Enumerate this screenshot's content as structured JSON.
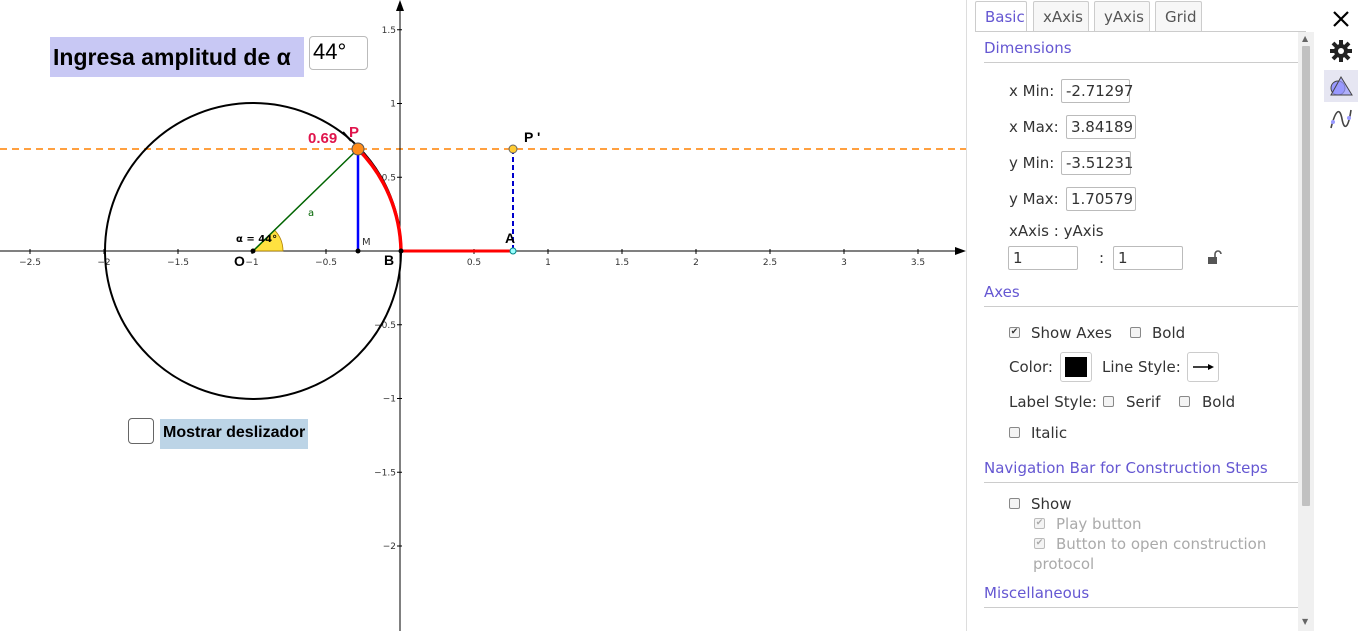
{
  "input": {
    "label": "Ingresa amplitud de α",
    "value": "44°"
  },
  "checkbox": {
    "label": "Mostrar deslizador"
  },
  "graph": {
    "x_ticks": [
      "−2.5",
      "−2",
      "−1.5",
      "−1",
      "−0.5",
      "0.5",
      "1",
      "1.5",
      "2",
      "2.5",
      "3",
      "3.5"
    ],
    "y_ticks": [
      "1.5",
      "1",
      "0.5",
      "−0.5",
      "−1",
      "−1.5",
      "−2"
    ],
    "value_label": "0.69",
    "point_labels": {
      "P": "P",
      "P_prime": "P '",
      "O": "O",
      "B": "B",
      "A": "A",
      "M": "M",
      "segment_a": "a"
    },
    "angle_label": "α = 44°",
    "colors": {
      "circle": "#000000",
      "arc": "#ff0000",
      "radius": "#006400",
      "vertical": "#0000ff",
      "dashed": "#ff8000",
      "point": "#ff9900",
      "angle_fill": "#ffd700"
    }
  },
  "panel": {
    "tabs": [
      "Basic",
      "xAxis",
      "yAxis",
      "Grid"
    ],
    "active_tab": "Basic",
    "dimensions_title": "Dimensions",
    "x_min_label": "x Min:",
    "x_min_value": "-2.71297",
    "x_max_label": "x Max:",
    "x_max_value": "3.84189",
    "y_min_label": "y Min:",
    "y_min_value": "-3.51231",
    "y_max_label": "y Max:",
    "y_max_value": "1.70579",
    "ratio_label": "xAxis : yAxis",
    "ratio_x": "1",
    "ratio_sep": ":",
    "ratio_y": "1",
    "axes_title": "Axes",
    "show_axes_label": "Show Axes",
    "show_axes_checked": true,
    "bold_label": "Bold",
    "color_label": "Color:",
    "line_style_label": "Line Style:",
    "label_style_label": "Label Style:",
    "serif_label": "Serif",
    "bold2_label": "Bold",
    "italic_label": "Italic",
    "nav_title": "Navigation Bar for Construction Steps",
    "show_label": "Show",
    "play_button_label": "Play button",
    "open_protocol_label_1": "Button to open construction",
    "open_protocol_label_2": "protocol",
    "misc_title": "Miscellaneous"
  },
  "right_toolbar": [
    "close-icon",
    "gear-icon",
    "geometry-view-icon",
    "graph-view-icon"
  ]
}
